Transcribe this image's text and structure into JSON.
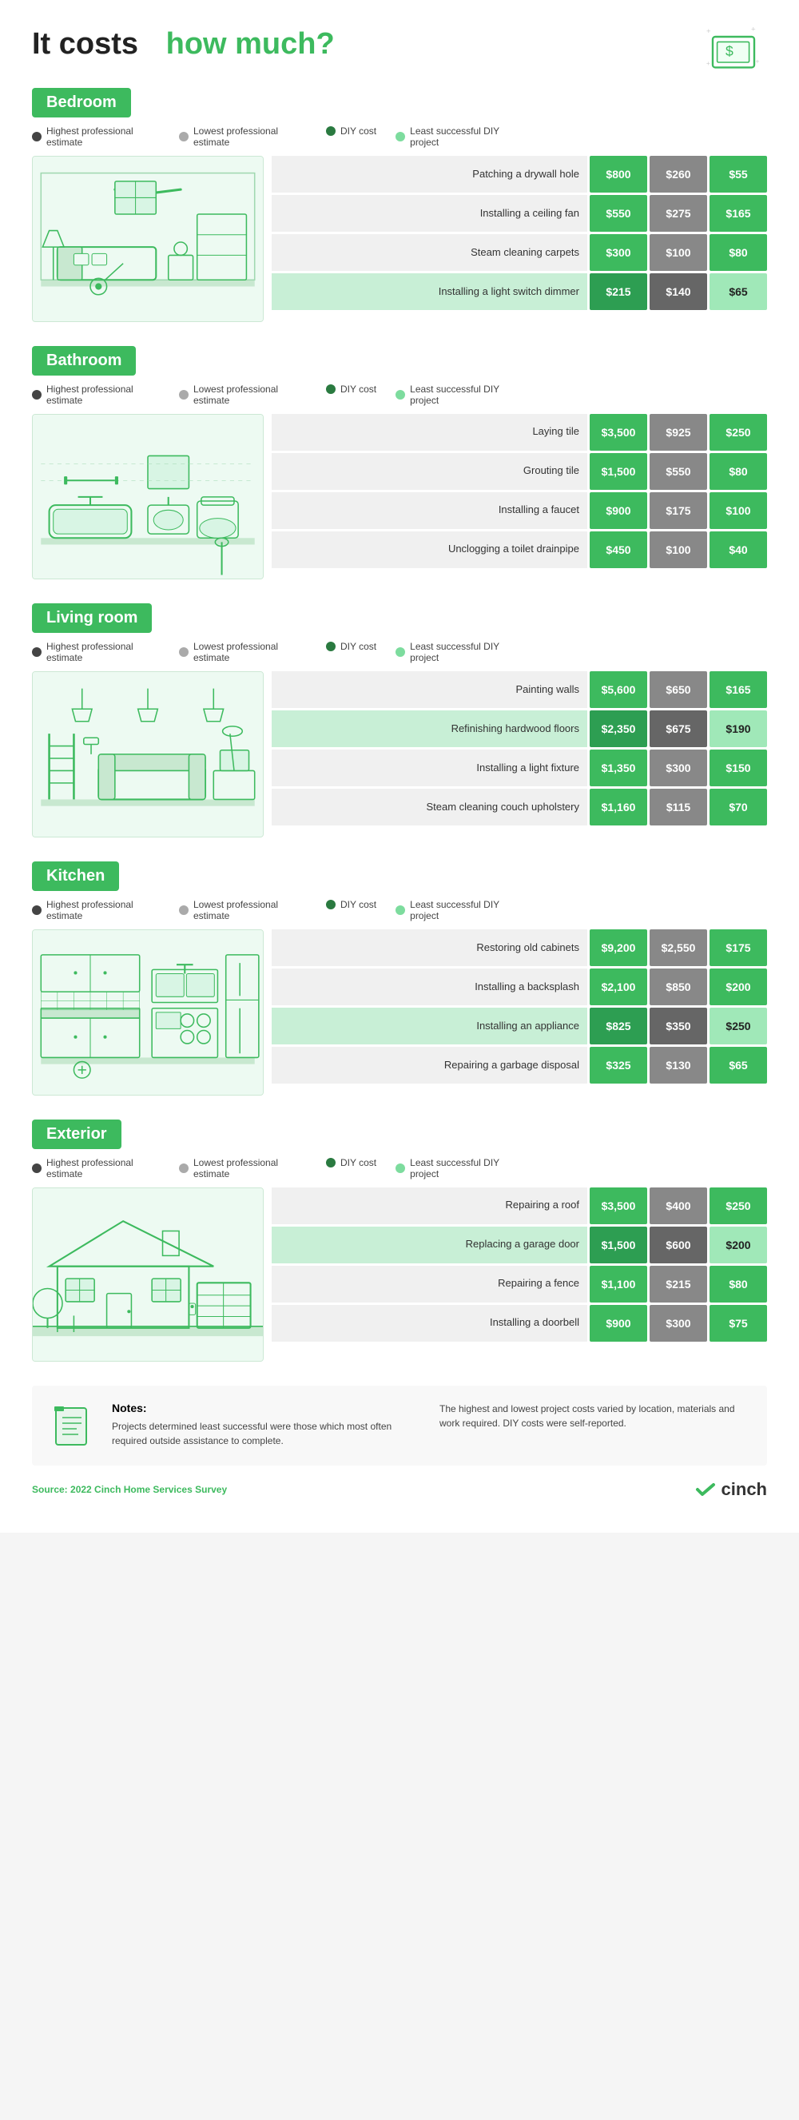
{
  "title": {
    "prefix": "It costs",
    "highlight": "how much?",
    "source_label": "Source:",
    "source_text": "2022 Cinch Home Services Survey"
  },
  "legend": {
    "items": [
      {
        "label": "Highest professional estimate",
        "dot": "dark"
      },
      {
        "label": "Lowest professional estimate",
        "dot": "gray"
      },
      {
        "label": "DIY cost",
        "dot": "darkgreen"
      },
      {
        "label": "Least successful DIY project",
        "dot": "lightgreen"
      }
    ]
  },
  "sections": [
    {
      "id": "bedroom",
      "title": "Bedroom",
      "rows": [
        {
          "task": "Patching a drywall hole",
          "high": "$800",
          "low": "$260",
          "diy": "$55",
          "highlight": false
        },
        {
          "task": "Installing a ceiling fan",
          "high": "$550",
          "low": "$275",
          "diy": "$165",
          "highlight": false
        },
        {
          "task": "Steam cleaning carpets",
          "high": "$300",
          "low": "$100",
          "diy": "$80",
          "highlight": false
        },
        {
          "task": "Installing a light switch dimmer",
          "high": "$215",
          "low": "$140",
          "diy": "$65",
          "highlight": true
        }
      ]
    },
    {
      "id": "bathroom",
      "title": "Bathroom",
      "rows": [
        {
          "task": "Laying tile",
          "high": "$3,500",
          "low": "$925",
          "diy": "$250",
          "highlight": false
        },
        {
          "task": "Grouting tile",
          "high": "$1,500",
          "low": "$550",
          "diy": "$80",
          "highlight": false
        },
        {
          "task": "Installing a faucet",
          "high": "$900",
          "low": "$175",
          "diy": "$100",
          "highlight": false
        },
        {
          "task": "Unclogging a toilet drainpipe",
          "high": "$450",
          "low": "$100",
          "diy": "$40",
          "highlight": false
        }
      ]
    },
    {
      "id": "living-room",
      "title": "Living room",
      "rows": [
        {
          "task": "Painting walls",
          "high": "$5,600",
          "low": "$650",
          "diy": "$165",
          "highlight": false
        },
        {
          "task": "Refinishing hardwood floors",
          "high": "$2,350",
          "low": "$675",
          "diy": "$190",
          "highlight": true
        },
        {
          "task": "Installing a light fixture",
          "high": "$1,350",
          "low": "$300",
          "diy": "$150",
          "highlight": false
        },
        {
          "task": "Steam cleaning couch upholstery",
          "high": "$1,160",
          "low": "$115",
          "diy": "$70",
          "highlight": false
        }
      ]
    },
    {
      "id": "kitchen",
      "title": "Kitchen",
      "rows": [
        {
          "task": "Restoring old cabinets",
          "high": "$9,200",
          "low": "$2,550",
          "diy": "$175",
          "highlight": false
        },
        {
          "task": "Installing a backsplash",
          "high": "$2,100",
          "low": "$850",
          "diy": "$200",
          "highlight": false
        },
        {
          "task": "Installing an appliance",
          "high": "$825",
          "low": "$350",
          "diy": "$250",
          "highlight": true
        },
        {
          "task": "Repairing a garbage disposal",
          "high": "$325",
          "low": "$130",
          "diy": "$65",
          "highlight": false
        }
      ]
    },
    {
      "id": "exterior",
      "title": "Exterior",
      "rows": [
        {
          "task": "Repairing a roof",
          "high": "$3,500",
          "low": "$400",
          "diy": "$250",
          "highlight": false
        },
        {
          "task": "Replacing a garage door",
          "high": "$1,500",
          "low": "$600",
          "diy": "$200",
          "highlight": true
        },
        {
          "task": "Repairing a fence",
          "high": "$1,100",
          "low": "$215",
          "diy": "$80",
          "highlight": false
        },
        {
          "task": "Installing a doorbell",
          "high": "$900",
          "low": "$300",
          "diy": "$75",
          "highlight": false
        }
      ]
    }
  ],
  "notes": {
    "title": "Notes:",
    "left": "Projects determined least successful were those which most often required outside assistance to complete.",
    "right": "The highest and lowest project costs varied by location, materials and work required. DIY costs were self-reported."
  }
}
